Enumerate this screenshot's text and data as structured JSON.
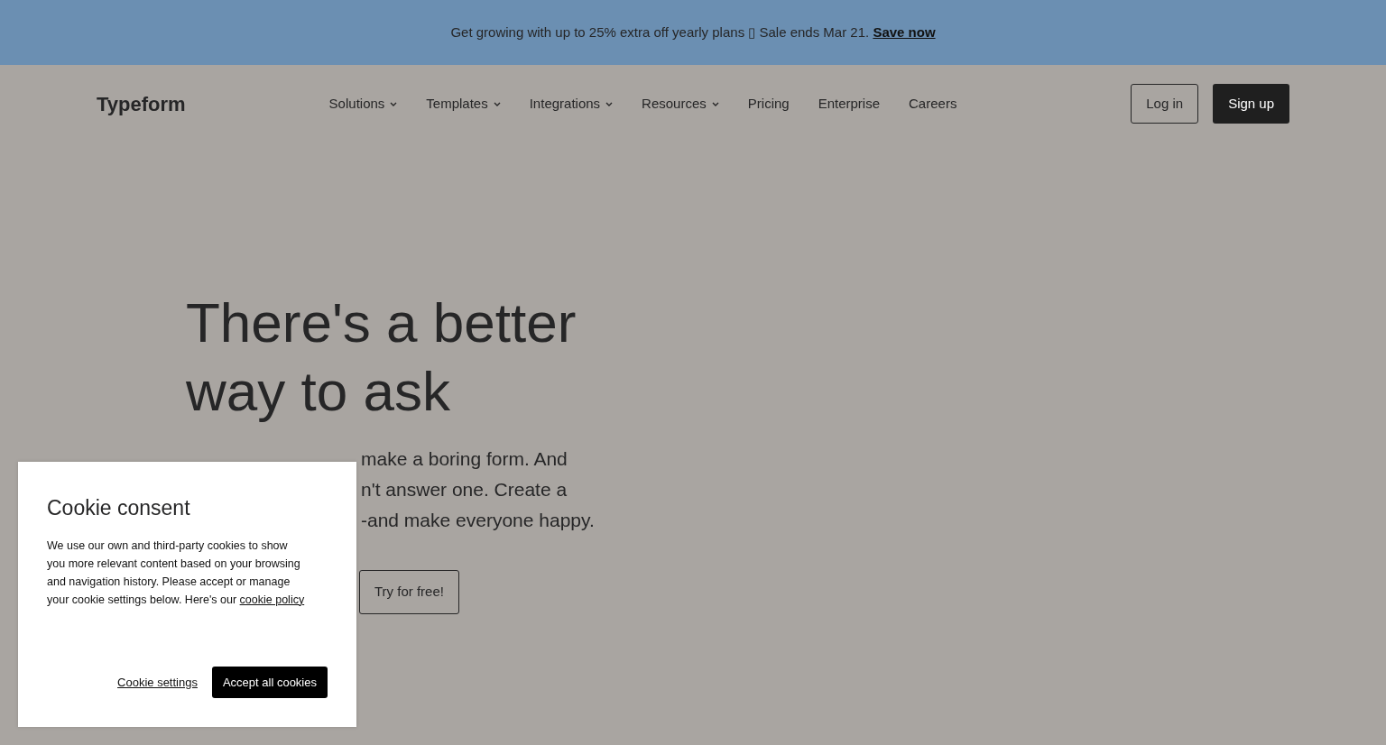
{
  "banner": {
    "text": "Get growing with up to 25% extra off yearly plans ▯ Sale ends Mar 21.",
    "link": "Save now"
  },
  "navbar": {
    "logo": "Typeform",
    "items": [
      {
        "label": "Solutions",
        "dropdown": true
      },
      {
        "label": "Templates",
        "dropdown": true
      },
      {
        "label": "Integrations",
        "dropdown": true
      },
      {
        "label": "Resources",
        "dropdown": true
      },
      {
        "label": "Pricing",
        "dropdown": false
      },
      {
        "label": "Enterprise",
        "dropdown": false
      },
      {
        "label": "Careers",
        "dropdown": false
      }
    ],
    "login": "Log in",
    "signup": "Sign up"
  },
  "hero": {
    "title_lines": [
      "There's a better",
      "way to ask"
    ],
    "text_lines": [
      "make a boring form. And",
      "n't answer one. Create a",
      "-and make everyone happy."
    ],
    "button": "Try for free!"
  },
  "cookie_dialog": {
    "title": "Cookie consent",
    "text": "We use our own and third-party cookies to show you more relevant content based on your browsing and navigation history. Please accept or manage your cookie settings below. Here's our",
    "policy_link": "cookie policy",
    "settings": "Cookie settings",
    "accept": "Accept all cookies"
  }
}
